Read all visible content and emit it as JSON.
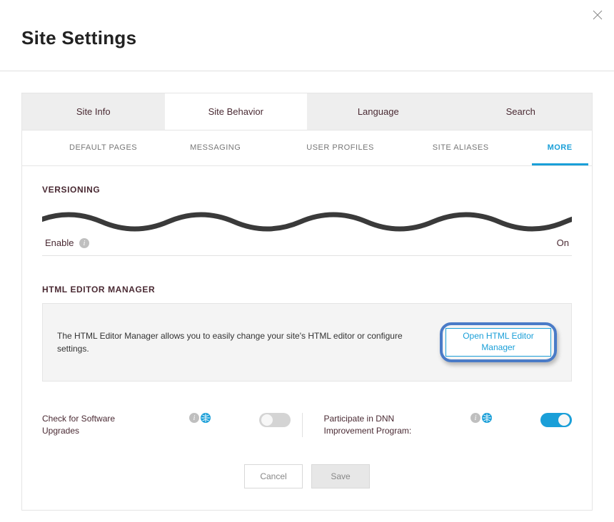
{
  "header": {
    "title": "Site Settings"
  },
  "tabs_main": {
    "items": [
      "Site Info",
      "Site Behavior",
      "Language",
      "Search"
    ],
    "active_index": 1
  },
  "tabs_sub": {
    "items": [
      "DEFAULT PAGES",
      "MESSAGING",
      "USER PROFILES",
      "SITE ALIASES",
      "MORE"
    ],
    "active_index": 4
  },
  "versioning": {
    "heading": "VERSIONING",
    "enable_label_partial_left": "Enable",
    "enable_on_partial": "On"
  },
  "html_editor": {
    "heading": "HTML EDITOR MANAGER",
    "description": "The HTML Editor Manager allows you to easily change your site's HTML editor or configure settings.",
    "open_button": "Open HTML Editor Manager"
  },
  "toggles": {
    "left": {
      "label": "Check for Software Upgrades",
      "value": false
    },
    "right": {
      "label": "Participate in DNN Improvement Program:",
      "value": true
    }
  },
  "actions": {
    "cancel": "Cancel",
    "save": "Save"
  }
}
